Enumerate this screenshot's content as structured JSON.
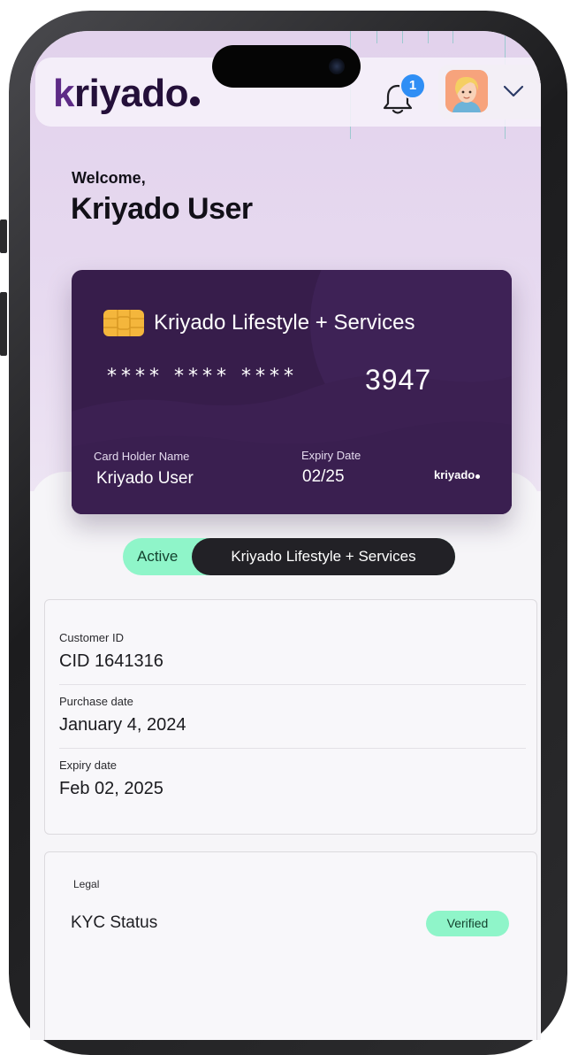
{
  "header": {
    "logo_main": "riyado",
    "logo_k": "k",
    "notification_count": "1"
  },
  "welcome": {
    "greeting": "Welcome,",
    "user_name": "Kriyado User"
  },
  "card": {
    "title": "Kriyado Lifestyle + Services",
    "masked_number": "**** **** ****",
    "last_four": "3947",
    "holder_label": "Card Holder Name",
    "holder_name": "Kriyado User",
    "expiry_label": "Expiry Date",
    "expiry_value": "02/25",
    "brand": "kriyado"
  },
  "status": {
    "state": "Active",
    "plan": "Kriyado Lifestyle + Services"
  },
  "details": [
    {
      "label": "Customer ID",
      "value": "CID 1641316"
    },
    {
      "label": "Purchase date",
      "value": "January 4, 2024"
    },
    {
      "label": "Expiry date",
      "value": "Feb 02, 2025"
    }
  ],
  "legal": {
    "title": "Legal",
    "kyc_label": "KYC Status",
    "kyc_status": "Verified"
  },
  "colors": {
    "brand_purple": "#5d2a86",
    "card_bg": "#371d4b",
    "status_green": "#8ff5c9",
    "badge_blue": "#2f8ef5"
  },
  "icons": [
    "bell-icon",
    "chevron-down-icon",
    "avatar",
    "chip-icon"
  ]
}
